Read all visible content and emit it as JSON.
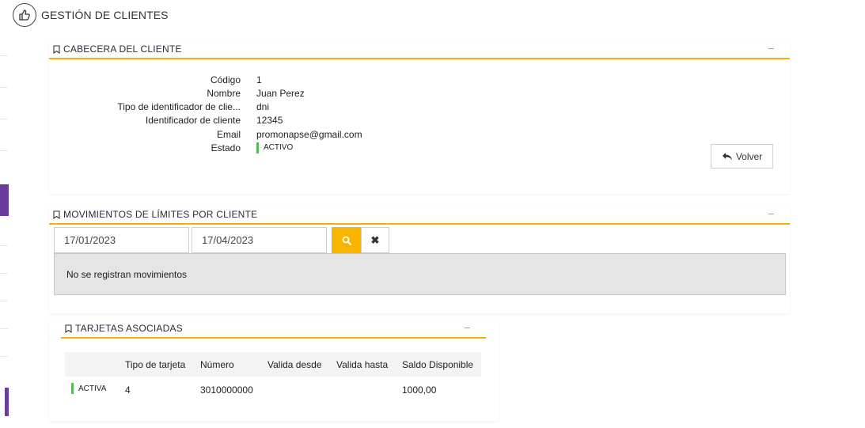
{
  "page": {
    "title": "GESTIÓN DE CLIENTES"
  },
  "cabecera": {
    "title": "CABECERA DEL CLIENTE",
    "collapse": "–",
    "fields": [
      {
        "label": "Código",
        "value": "1"
      },
      {
        "label": "Nombre",
        "value": "Juan Perez"
      },
      {
        "label": "Tipo de identificador de clie...",
        "value": "dni"
      },
      {
        "label": "Identificador de cliente",
        "value": "12345"
      },
      {
        "label": "Email",
        "value": "promonapse@gmail.com"
      }
    ],
    "estado_label": "Estado",
    "estado_value": "ACTIVO",
    "volver_label": "Volver"
  },
  "movimientos": {
    "title": "MOVIMIENTOS DE LÍMITES POR CLIENTE",
    "collapse": "–",
    "date_from": "17/01/2023",
    "date_to": "17/04/2023",
    "clear_label": "✖",
    "empty_message": "No se registran movimientos"
  },
  "tarjetas": {
    "title": "TARJETAS ASOCIADAS",
    "collapse": "–",
    "columns": [
      "",
      "Tipo de tarjeta",
      "Número",
      "Valida desde",
      "Valida hasta",
      "Saldo Disponible"
    ],
    "rows": [
      {
        "estado": "ACTIVA",
        "tipo": "4",
        "numero": "3010000000",
        "desde": "",
        "hasta": "",
        "saldo": "1000,00"
      }
    ]
  },
  "colors": {
    "accent": "#f0b400",
    "status_active": "#5cb85c",
    "rail": "#6a3d9a"
  },
  "icons": {
    "header": "thumbs-up-icon",
    "bookmark": "bookmark-icon",
    "volver": "reply-arrow-icon",
    "search": "search-icon",
    "clear": "close-icon"
  }
}
